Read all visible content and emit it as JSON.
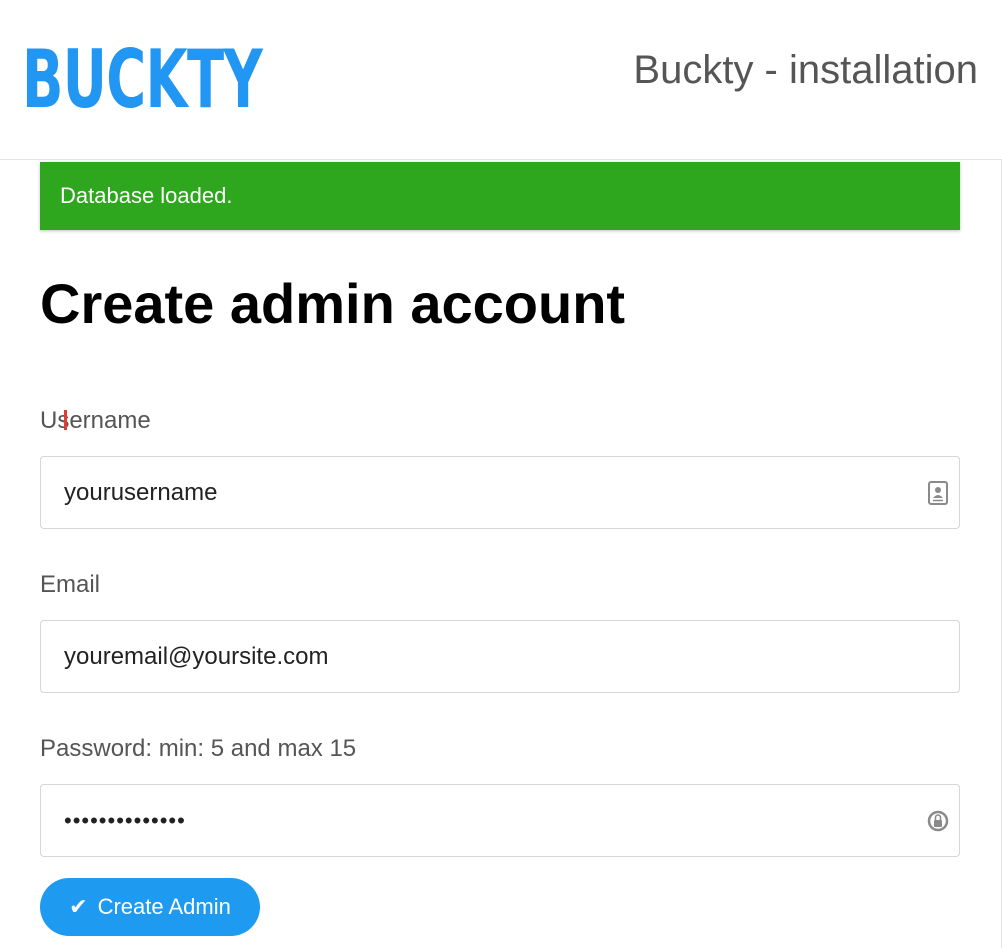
{
  "header": {
    "logo_text": "BUCKTY",
    "title": "Buckty - installation"
  },
  "alert": {
    "message": "Database loaded.",
    "color": "#2ea61d"
  },
  "page": {
    "title": "Create admin account"
  },
  "form": {
    "username": {
      "label": "Username",
      "value": "yourusername",
      "icon": "contact-card-icon"
    },
    "email": {
      "label": "Email",
      "value": "youremail@yoursite.com"
    },
    "password": {
      "label": "Password: min: 5 and max 15",
      "value": "••••••••••••••",
      "icon": "password-key-icon"
    },
    "submit": {
      "label": "Create Admin",
      "icon": "checkmark-icon"
    }
  },
  "colors": {
    "brand": "#2196f3",
    "button": "#1e9bf0",
    "success": "#2ea61d"
  }
}
